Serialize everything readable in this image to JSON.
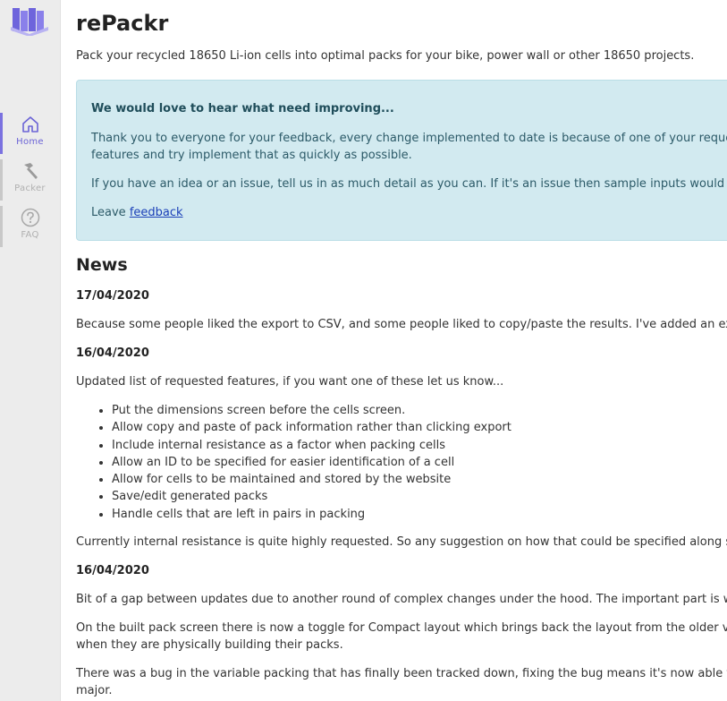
{
  "sidebar": {
    "logo": "books-logo-icon",
    "items": [
      {
        "label": "Home",
        "icon": "home-icon",
        "active": true
      },
      {
        "label": "Packer",
        "icon": "hammer-icon",
        "active": false
      },
      {
        "label": "FAQ",
        "icon": "question-circle-icon",
        "active": false
      }
    ]
  },
  "page": {
    "title": "rePackr",
    "subtitle": "Pack your recycled 18650 Li-ion cells into optimal packs for your bike, power wall or other 18650 projects."
  },
  "alert": {
    "heading": "We would love to hear what need improving...",
    "p1_line1": "Thank you to everyone for your feedback, every change implemented to date is because of one of your requests. W",
    "p1_line2": "features and try implement that as quickly as possible.",
    "p2": "If you have an idea or an issue, tell us in as much detail as you can. If it's an issue then sample inputs would reall",
    "p3_prefix": "Leave ",
    "p3_link": "feedback"
  },
  "news": {
    "heading": "News",
    "entries": [
      {
        "date": "17/04/2020",
        "text": "Because some people liked the export to CSV, and some people liked to copy/paste the results. I've added an extra b"
      },
      {
        "date": "16/04/2020",
        "text": "Updated list of requested features, if you want one of these let us know...",
        "features": [
          "Put the dimensions screen before the cells screen.",
          "Allow copy and paste of pack information rather than clicking export",
          "Include internal resistance as a factor when packing cells",
          "Allow an ID to be specified for easier identification of a cell",
          "Allow for cells to be maintained and stored by the website",
          "Save/edit generated packs",
          "Handle cells that are left in pairs in packing"
        ],
        "after": "Currently internal resistance is quite highly requested. So any suggestion on how that could be specified along side"
      },
      {
        "date": "16/04/2020",
        "text1": "Bit of a gap between updates due to another round of complex changes under the hood. The important part is what's",
        "text2_line1": "On the built pack screen there is now a toggle for Compact layout which brings back the layout from the older versio",
        "text2_line2": "when they are physically building their packs.",
        "text3_line1": "There was a bug in the variable packing that has finally been tracked down, fixing the bug means it's now able to do",
        "text3_line2": "major."
      }
    ]
  },
  "colors": {
    "accent": "#7b72e0",
    "alert_bg": "#d2eaf0",
    "link": "#1a3fb8"
  }
}
